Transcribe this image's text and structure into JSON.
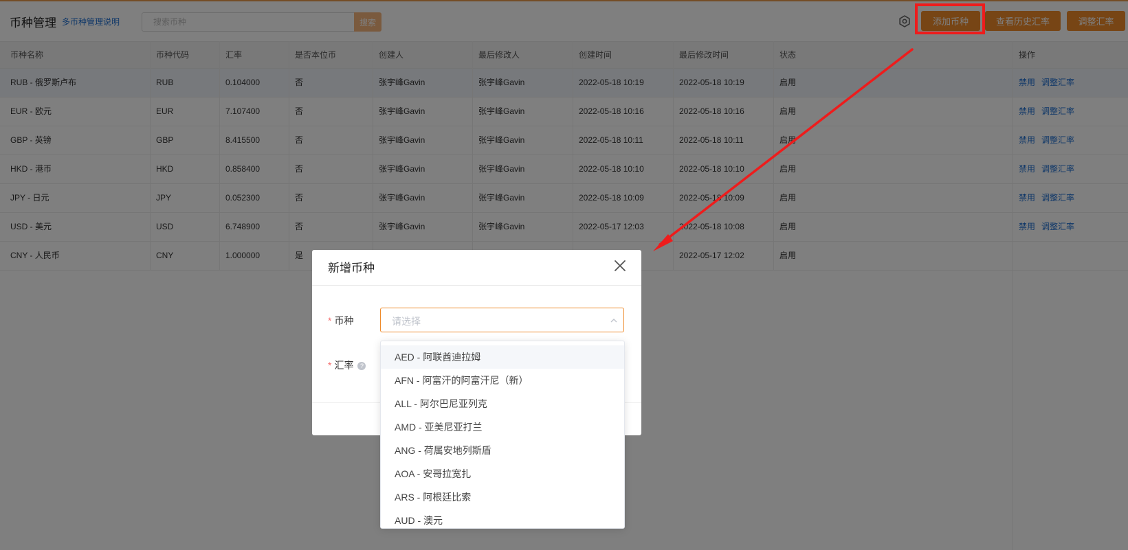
{
  "header": {
    "title": "币种管理",
    "help_link": "多币种管理说明",
    "search_placeholder": "搜索币种",
    "search_button": "搜索",
    "add_button": "添加币种",
    "history_button": "查看历史汇率",
    "adjust_button": "调整汇率"
  },
  "table": {
    "columns": [
      "币种名称",
      "币种代码",
      "汇率",
      "是否本位币",
      "创建人",
      "最后修改人",
      "创建时间",
      "最后修改时间",
      "状态",
      "操作"
    ],
    "rows": [
      {
        "name": "RUB - 俄罗斯卢布",
        "code": "RUB",
        "rate": "0.104000",
        "base": "否",
        "creator": "张宇峰Gavin",
        "modifier": "张宇峰Gavin",
        "created": "2022-05-18 10:19",
        "modified": "2022-05-18 10:19",
        "status": "启用",
        "op1": "禁用",
        "op2": "调整汇率"
      },
      {
        "name": "EUR - 欧元",
        "code": "EUR",
        "rate": "7.107400",
        "base": "否",
        "creator": "张宇峰Gavin",
        "modifier": "张宇峰Gavin",
        "created": "2022-05-18 10:16",
        "modified": "2022-05-18 10:16",
        "status": "启用",
        "op1": "禁用",
        "op2": "调整汇率"
      },
      {
        "name": "GBP - 英镑",
        "code": "GBP",
        "rate": "8.415500",
        "base": "否",
        "creator": "张宇峰Gavin",
        "modifier": "张宇峰Gavin",
        "created": "2022-05-18 10:11",
        "modified": "2022-05-18 10:11",
        "status": "启用",
        "op1": "禁用",
        "op2": "调整汇率"
      },
      {
        "name": "HKD - 港币",
        "code": "HKD",
        "rate": "0.858400",
        "base": "否",
        "creator": "张宇峰Gavin",
        "modifier": "张宇峰Gavin",
        "created": "2022-05-18 10:10",
        "modified": "2022-05-18 10:10",
        "status": "启用",
        "op1": "禁用",
        "op2": "调整汇率"
      },
      {
        "name": "JPY - 日元",
        "code": "JPY",
        "rate": "0.052300",
        "base": "否",
        "creator": "张宇峰Gavin",
        "modifier": "张宇峰Gavin",
        "created": "2022-05-18 10:09",
        "modified": "2022-05-18 10:09",
        "status": "启用",
        "op1": "禁用",
        "op2": "调整汇率"
      },
      {
        "name": "USD - 美元",
        "code": "USD",
        "rate": "6.748900",
        "base": "否",
        "creator": "张宇峰Gavin",
        "modifier": "张宇峰Gavin",
        "created": "2022-05-17 12:03",
        "modified": "2022-05-18 10:08",
        "status": "启用",
        "op1": "禁用",
        "op2": "调整汇率"
      },
      {
        "name": "CNY - 人民币",
        "code": "CNY",
        "rate": "1.000000",
        "base": "是",
        "creator": "",
        "modifier": "",
        "created": "",
        "modified": "2022-05-17 12:02",
        "status": "启用",
        "op1": "",
        "op2": ""
      }
    ]
  },
  "modal": {
    "title": "新增币种",
    "currency_label": "币种",
    "rate_label": "汇率",
    "required_mark": "*",
    "help_icon_text": "?",
    "select_placeholder": "请选择"
  },
  "dropdown": {
    "options": [
      "AED - 阿联酋迪拉姆",
      "AFN - 阿富汗的阿富汗尼（新）",
      "ALL - 阿尔巴尼亚列克",
      "AMD - 亚美尼亚打兰",
      "ANG - 荷属安地列斯盾",
      "AOA - 安哥拉宽扎",
      "ARS - 阿根廷比索",
      "AUD - 澳元"
    ]
  },
  "colors": {
    "accent": "#ee8a2a",
    "link": "#1f6fd1",
    "annotation": "#ee1c1c"
  },
  "icons": {
    "settings": "gear-icon",
    "close": "close-icon",
    "select_chevron": "chevron-up-icon",
    "help": "help-circle-icon"
  }
}
